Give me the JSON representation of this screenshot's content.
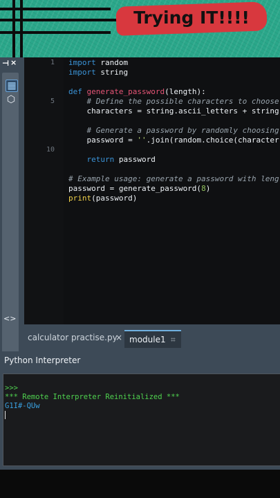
{
  "banner": {
    "title": "Trying IT!!!!"
  },
  "editor": {
    "line_numbers": [
      "1",
      "5",
      "10"
    ],
    "lines": [
      [
        {
          "t": "import",
          "c": "k"
        },
        {
          "t": " random",
          "c": "n"
        }
      ],
      [
        {
          "t": "import",
          "c": "k"
        },
        {
          "t": " string",
          "c": "n"
        }
      ],
      [],
      [
        {
          "t": "def ",
          "c": "k"
        },
        {
          "t": "generate_password",
          "c": "f"
        },
        {
          "t": "(length):",
          "c": "p"
        }
      ],
      [
        {
          "t": "    # Define the possible characters to choose",
          "c": "c"
        }
      ],
      [
        {
          "t": "    characters = string.ascii_letters + string",
          "c": "n"
        }
      ],
      [],
      [
        {
          "t": "    # Generate a password by randomly choosing",
          "c": "c"
        }
      ],
      [
        {
          "t": "    password = ",
          "c": "n"
        },
        {
          "t": "''",
          "c": "s"
        },
        {
          "t": ".join(random.choice(character",
          "c": "n"
        }
      ],
      [],
      [
        {
          "t": "    ",
          "c": "n"
        },
        {
          "t": "return",
          "c": "k"
        },
        {
          "t": " password",
          "c": "n"
        }
      ],
      [],
      [
        {
          "t": "# Example usage: generate a password with leng",
          "c": "c"
        }
      ],
      [
        {
          "t": "password = generate_password(",
          "c": "n"
        },
        {
          "t": "8",
          "c": "num"
        },
        {
          "t": ")",
          "c": "n"
        }
      ],
      [
        {
          "t": "print",
          "c": "b"
        },
        {
          "t": "(password)",
          "c": "n"
        }
      ]
    ]
  },
  "tabs": [
    {
      "label": "calculator practise.py",
      "close": "×"
    },
    {
      "label": "module1",
      "pin": "⌗"
    }
  ],
  "interpreter": {
    "title": "Python Interpreter",
    "prompt": ">>>",
    "message": "*** Remote Interpreter Reinitialized ***",
    "output": "G1I#-QUw"
  },
  "toolstrip": {
    "pin": "⊣",
    "close": "×",
    "arrows": "<>"
  },
  "colors": {
    "banner": "#2aa78a",
    "title_bg": "#d8383e",
    "keyword": "#3b94d8",
    "function": "#e45475",
    "comment": "#99a4ad",
    "ide_bg": "#3d4a57"
  }
}
